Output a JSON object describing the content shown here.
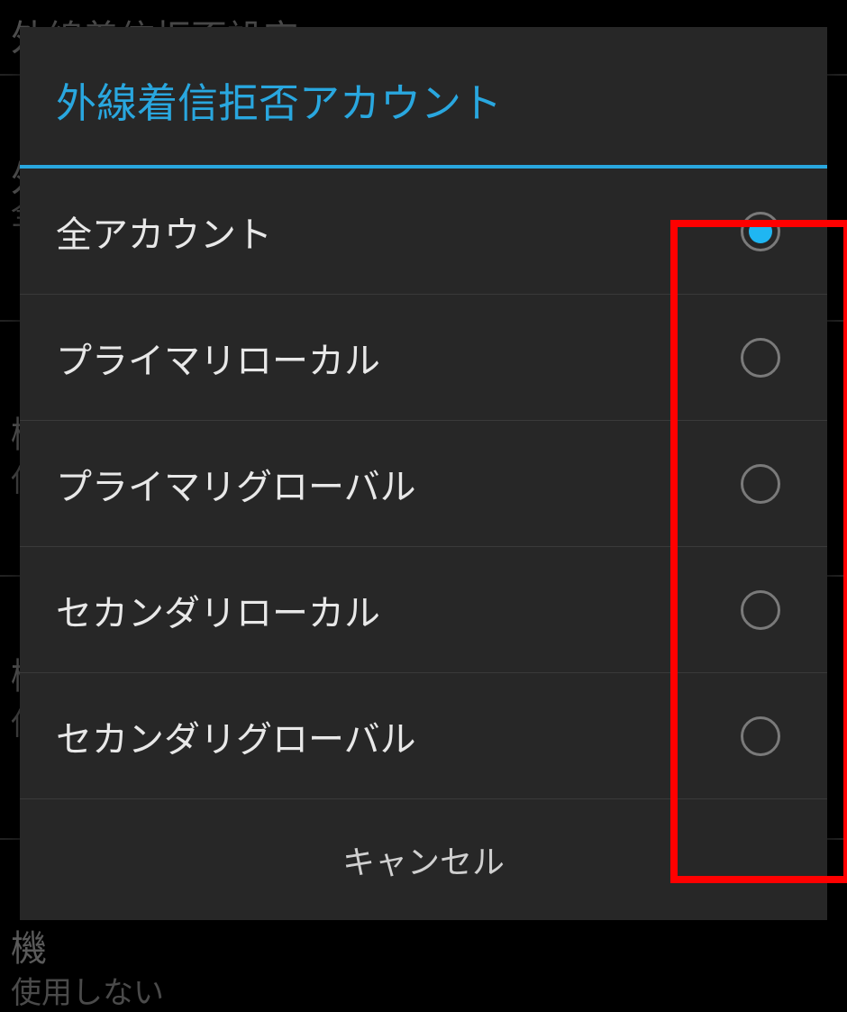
{
  "background": {
    "row1": "外線着信拒否設定",
    "row2": "外",
    "row3": "全",
    "row4": "機",
    "row5": "使",
    "row6": "機",
    "row7": "使",
    "row8": "機",
    "row9": "使用しない"
  },
  "dialog": {
    "title": "外線着信拒否アカウント",
    "options": [
      {
        "label": "全アカウント",
        "selected": true
      },
      {
        "label": "プライマリローカル",
        "selected": false
      },
      {
        "label": "プライマリグローバル",
        "selected": false
      },
      {
        "label": "セカンダリローカル",
        "selected": false
      },
      {
        "label": "セカンダリグローバル",
        "selected": false
      }
    ],
    "cancel": "キャンセル"
  },
  "colors": {
    "accent": "#29a7df",
    "highlight": "#ff0000"
  }
}
